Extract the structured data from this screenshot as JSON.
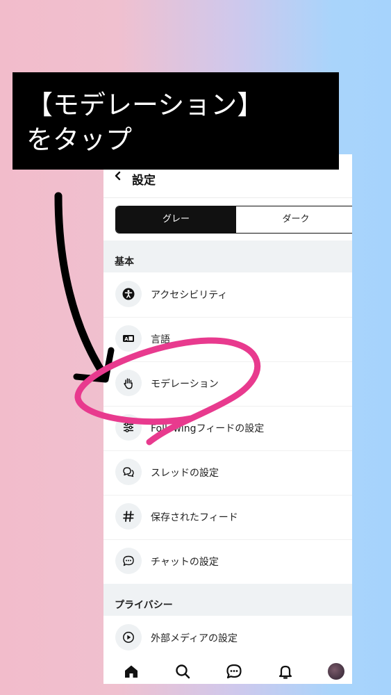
{
  "callout": {
    "line1": "【モデレーション】",
    "line2": "をタップ"
  },
  "header": {
    "title": "設定",
    "back_icon": "chevron-left-icon"
  },
  "theme": {
    "options": [
      "グレー",
      "ダーク"
    ],
    "selected": "グレー"
  },
  "sections": [
    {
      "heading": "基本",
      "items": [
        {
          "label": "アクセシビリティ",
          "icon": "accessibility-icon"
        },
        {
          "label": "言語",
          "icon": "language-icon"
        },
        {
          "label": "モデレーション",
          "icon": "hand-icon"
        },
        {
          "label": "Followingフィードの設定",
          "icon": "sliders-icon"
        },
        {
          "label": "スレッドの設定",
          "icon": "chat-bubbles-icon"
        },
        {
          "label": "保存されたフィード",
          "icon": "hash-icon"
        },
        {
          "label": "チャットの設定",
          "icon": "chat-icon"
        }
      ]
    },
    {
      "heading": "プライバシー",
      "items": [
        {
          "label": "外部メディアの設定",
          "icon": "play-circle-icon"
        }
      ]
    }
  ],
  "tabbar": [
    "home-icon",
    "search-icon",
    "chat-icon",
    "bell-icon",
    "avatar"
  ],
  "colors": {
    "highlight": "#e83a8e",
    "accent": "#111111",
    "section_bg": "#eff2f4"
  }
}
